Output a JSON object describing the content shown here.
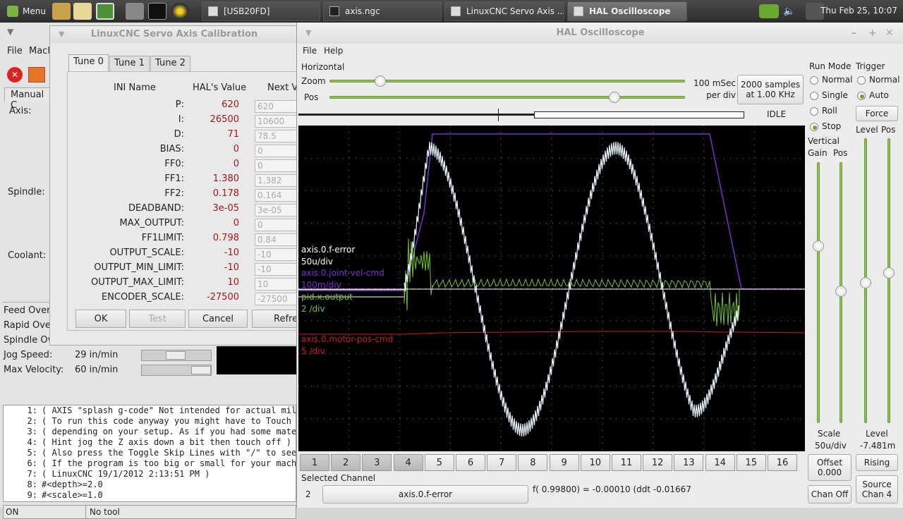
{
  "panel": {
    "menu_label": "Menu",
    "tasks": [
      "[USB20FD]",
      "axis.ngc",
      "LinuxCNC Servo Axis ...",
      "HAL Oscilloscope"
    ],
    "clock": "Thu Feb 25, 10:07"
  },
  "axis": {
    "menu": [
      "File",
      "Mach"
    ],
    "manual_tab": "Manual C",
    "axis_label": "Axis:",
    "spindle_label": "Spindle:",
    "coolant_label": "Coolant:",
    "feed_override": "Feed Overr",
    "rapid_override": "Rapid Over",
    "spindle_override": "Spindle Ov",
    "jog_speed_label": "Jog Speed:",
    "jog_speed_value": "29 in/min",
    "max_velocity_label": "Max Velocity:",
    "max_velocity_value": "60 in/min",
    "gcode_lines": [
      {
        "n": "1:",
        "t": "( AXIS \"splash g-code\" Not intended for actual mill"
      },
      {
        "n": "2:",
        "t": "( To run this code anyway you might have to Touch O"
      },
      {
        "n": "3:",
        "t": "( depending on your setup. As if you had some mater"
      },
      {
        "n": "4:",
        "t": "( Hint jog the Z axis down a bit then touch off )"
      },
      {
        "n": "5:",
        "t": "( Also press the Toggle Skip Lines with \"/\" to see"
      },
      {
        "n": "6:",
        "t": "( If the program is too big or small for your machi"
      },
      {
        "n": "7:",
        "t": "( LinuxCNC 19/1/2012 2:13:51 PM )"
      },
      {
        "n": "8:",
        "t": "#<depth>=2.0"
      },
      {
        "n": "9:",
        "t": "#<scale>=1.0"
      }
    ],
    "status_state": "ON",
    "status_tool": "No tool"
  },
  "calib": {
    "title": "LinuxCNC Servo Axis Calibration",
    "tabs": [
      "Tune 0",
      "Tune 1",
      "Tune 2"
    ],
    "headers": {
      "ini": "INI Name",
      "hal": "HAL's Value",
      "next": "Next V"
    },
    "rows": [
      {
        "name": "P:",
        "hal": "620",
        "next": "620"
      },
      {
        "name": "I:",
        "hal": "26500",
        "next": "10600"
      },
      {
        "name": "D:",
        "hal": "71",
        "next": "78.5"
      },
      {
        "name": "BIAS:",
        "hal": "0",
        "next": "0"
      },
      {
        "name": "FF0:",
        "hal": "0",
        "next": "0"
      },
      {
        "name": "FF1:",
        "hal": "1.380",
        "next": "1.382"
      },
      {
        "name": "FF2:",
        "hal": "0.178",
        "next": "0.164"
      },
      {
        "name": "DEADBAND:",
        "hal": "3e-05",
        "next": "3e-05"
      },
      {
        "name": "MAX_OUTPUT:",
        "hal": "0",
        "next": "0"
      },
      {
        "name": "FF1LIMIT:",
        "hal": "0.798",
        "next": "0.84"
      },
      {
        "name": "OUTPUT_SCALE:",
        "hal": "-10",
        "next": "-10"
      },
      {
        "name": "OUTPUT_MIN_LIMIT:",
        "hal": "-10",
        "next": "-10"
      },
      {
        "name": "OUTPUT_MAX_LIMIT:",
        "hal": "10",
        "next": "10"
      },
      {
        "name": "ENCODER_SCALE:",
        "hal": "-27500",
        "next": "-27500"
      }
    ],
    "buttons": {
      "ok": "OK",
      "test": "Test",
      "cancel": "Cancel",
      "refresh": "Refre"
    }
  },
  "scope": {
    "title": "HAL Oscilloscope",
    "menu": [
      "File",
      "Help"
    ],
    "horizontal_label": "Horizontal",
    "zoom_label": "Zoom",
    "pos_label": "Pos",
    "zoom_level": 0.13,
    "pos_level": 0.81,
    "timebase": "100 mSec per div",
    "samples_button": "2000 samples at 1.00 KHz",
    "state": "IDLE",
    "run_mode_label": "Run Mode",
    "run_modes": [
      "Normal",
      "Single",
      "Roll",
      "Stop"
    ],
    "run_mode_selected": "Stop",
    "trigger_label": "Trigger",
    "trigger_modes": [
      "Normal",
      "Auto"
    ],
    "trigger_selected": "Auto",
    "force_button": "Force",
    "vertical_label": "Vertical",
    "gain_label": "Gain",
    "vpos_label": "Pos",
    "level_label": "Level",
    "tpos_label": "Pos",
    "scale_label": "Scale",
    "scale_value": "50u/div",
    "level_value_label": "Level",
    "level_value": "-7.481m",
    "offset_button": "Offset 0.000",
    "rising_button": "Rising",
    "chan_off_button": "Chan Off",
    "source_button": "Source Chan 4",
    "channels": [
      "1",
      "2",
      "3",
      "4",
      "5",
      "6",
      "7",
      "8",
      "9",
      "10",
      "11",
      "12",
      "13",
      "14",
      "15",
      "16"
    ],
    "selected_channel_label": "Selected Channel",
    "selected_channel_num": "2",
    "selected_channel_name": "axis.0.f-error",
    "readout": "f( 0.99800) = -0.00010 (ddt -0.01667",
    "traces": [
      {
        "name": "axis.0.f-error",
        "scale": "50u/div",
        "color": "#ffffff"
      },
      {
        "name": "axis.0.joint-vel-cmd",
        "scale": "100m/div",
        "color": "#7a2cd6"
      },
      {
        "name": "pid.x.output",
        "scale": "2 /div",
        "color": "#6fc52a"
      },
      {
        "name": "axis.0.motor-pos-cmd",
        "scale": "5 /div",
        "color": "#d11a1a"
      }
    ],
    "colors": {
      "accent": "#8fbf52"
    }
  }
}
